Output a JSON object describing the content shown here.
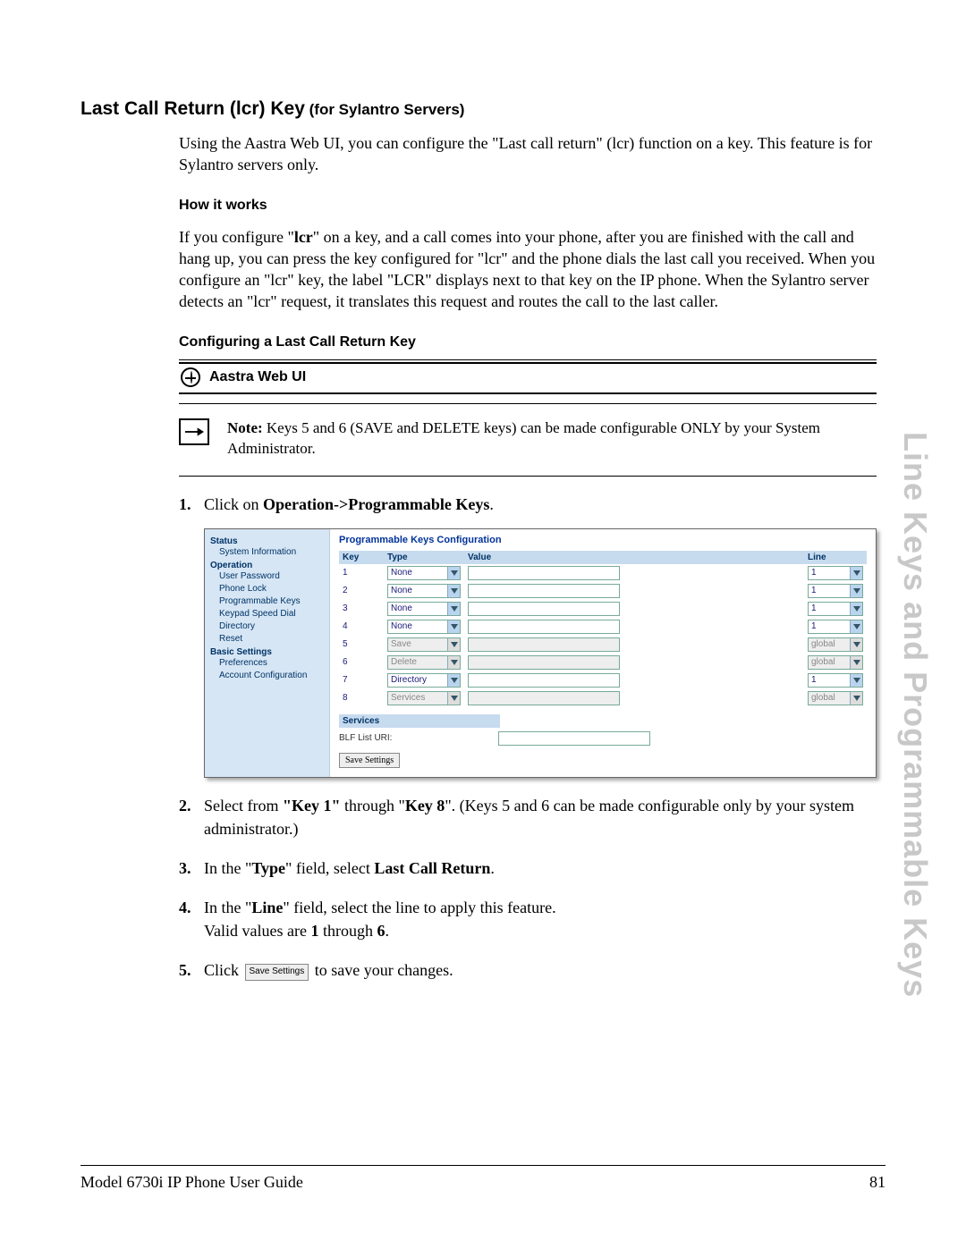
{
  "heading": {
    "main": "Last Call Return (lcr) Key",
    "sub": " (for Sylantro Servers)"
  },
  "intro": "Using the Aastra Web UI, you can configure the \"Last call return\" (lcr) function on a key. This feature is for Sylantro servers only.",
  "how_it_works": {
    "title": "How it works",
    "body_pre": "If you configure \"",
    "body_bold1": "lcr",
    "body_post": "\" on a key, and a call comes into your phone, after you are finished with the call and hang up, you can press the key configured for \"lcr\" and the phone dials the last call you received. When you configure an \"lcr\" key, the label \"LCR\" displays next to that key on the IP phone. When the Sylantro server detects an \"lcr\" request, it translates this request and routes the call to the last caller."
  },
  "configuring_title": "Configuring a Last Call Return Key",
  "webui_label": "Aastra Web UI",
  "note": {
    "label": "Note:",
    "text": " Keys 5 and 6 (SAVE and DELETE keys) can be made configurable ONLY by your System Administrator."
  },
  "steps": {
    "s1_num": "1.",
    "s1_pre": "Click on ",
    "s1_bold": "Operation->Programmable Keys",
    "s1_post": ".",
    "s2_num": "2.",
    "s2_pre": "Select from ",
    "s2_b1": "\"Key 1\"",
    "s2_mid": " through \"",
    "s2_b2": "Key 8",
    "s2_post": "\". (Keys 5 and 6 can be made configurable only by your system administrator.)",
    "s3_num": "3.",
    "s3_pre": "In the \"",
    "s3_b1": "Type",
    "s3_mid": "\" field, select ",
    "s3_b2": "Last Call Return",
    "s3_post": ".",
    "s4_num": "4.",
    "s4_pre": "In the \"",
    "s4_b1": "Line",
    "s4_mid": "\" field, select the line to apply this feature.",
    "s4_line2_pre": "Valid values are ",
    "s4_line2_b1": "1",
    "s4_line2_mid": " through ",
    "s4_line2_b2": "6",
    "s4_line2_post": ".",
    "s5_num": "5.",
    "s5_pre": "Click ",
    "s5_btn": "Save Settings",
    "s5_post": " to save your changes."
  },
  "screenshot": {
    "nav": {
      "status": "Status",
      "sysinfo": "System Information",
      "operation": "Operation",
      "user_password": "User Password",
      "phone_lock": "Phone Lock",
      "prog_keys": "Programmable Keys",
      "keypad": "Keypad Speed Dial",
      "directory": "Directory",
      "reset": "Reset",
      "basic": "Basic Settings",
      "preferences": "Preferences",
      "account": "Account Configuration"
    },
    "title": "Programmable Keys Configuration",
    "cols": {
      "key": "Key",
      "type": "Type",
      "value": "Value",
      "line": "Line"
    },
    "rows": [
      {
        "key": "1",
        "type": "None",
        "line": "1",
        "disabled": false
      },
      {
        "key": "2",
        "type": "None",
        "line": "1",
        "disabled": false
      },
      {
        "key": "3",
        "type": "None",
        "line": "1",
        "disabled": false
      },
      {
        "key": "4",
        "type": "None",
        "line": "1",
        "disabled": false
      },
      {
        "key": "5",
        "type": "Save",
        "line": "global",
        "disabled": true
      },
      {
        "key": "6",
        "type": "Delete",
        "line": "global",
        "disabled": true
      },
      {
        "key": "7",
        "type": "Directory",
        "line": "1",
        "disabled": false
      },
      {
        "key": "8",
        "type": "Services",
        "line": "global",
        "disabled": true
      }
    ],
    "services": "Services",
    "blf_label": "BLF List URI:",
    "save_btn": "Save Settings"
  },
  "side_title": "Line Keys and Programmable Keys",
  "footer": {
    "left": "Model 6730i IP Phone User Guide",
    "right": "81"
  }
}
